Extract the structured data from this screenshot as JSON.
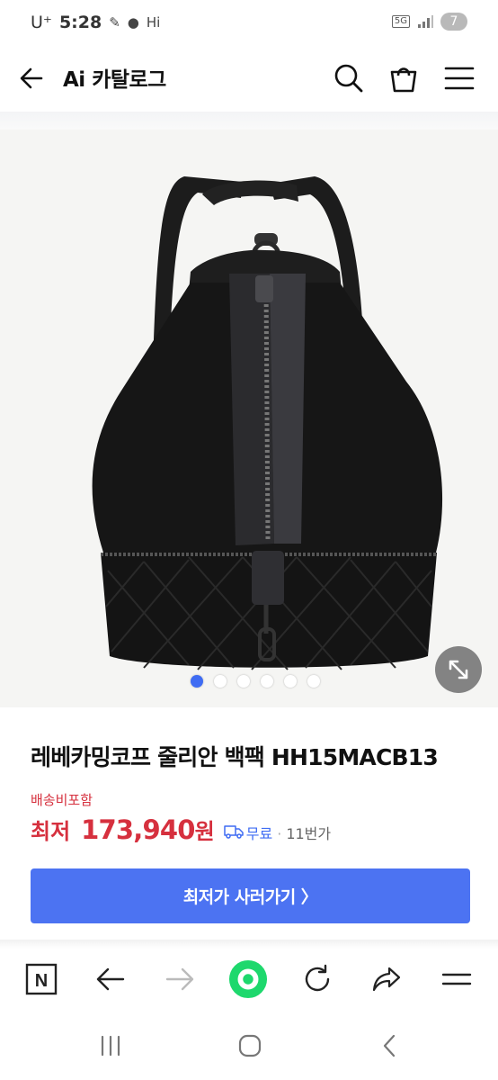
{
  "status_bar": {
    "carrier": "U⁺",
    "time": "5:28",
    "hi_label": "Hi",
    "network": "5G",
    "notification_count": "7"
  },
  "header": {
    "title": "Ai 카탈로그",
    "icons": [
      "back-arrow-icon",
      "search-icon",
      "cart-icon",
      "menu-icon"
    ]
  },
  "gallery": {
    "slide_count": 6,
    "active_slide": 1,
    "accent_color": "#3f6cf3"
  },
  "product": {
    "title": "레베카밍코프 줄리안 백팩 HH15MACB13",
    "shipping_note": "배송비포함",
    "price_label": "최저",
    "price_value": "173,940",
    "price_unit": "원",
    "shipping_free": "무료",
    "separator": "·",
    "seller_count": "11번가",
    "price_color": "#d6303e"
  },
  "cta": {
    "label": "최저가 사러가기 〉",
    "color": "#4c73f2"
  },
  "toolbar": {
    "n_label": "N",
    "icons": [
      "naver-n-icon",
      "back-icon",
      "forward-icon",
      "green-dot-icon",
      "refresh-icon",
      "share-icon",
      "menu-icon"
    ]
  },
  "system_nav": {
    "icons": [
      "recents-icon",
      "home-icon",
      "back-icon"
    ]
  }
}
